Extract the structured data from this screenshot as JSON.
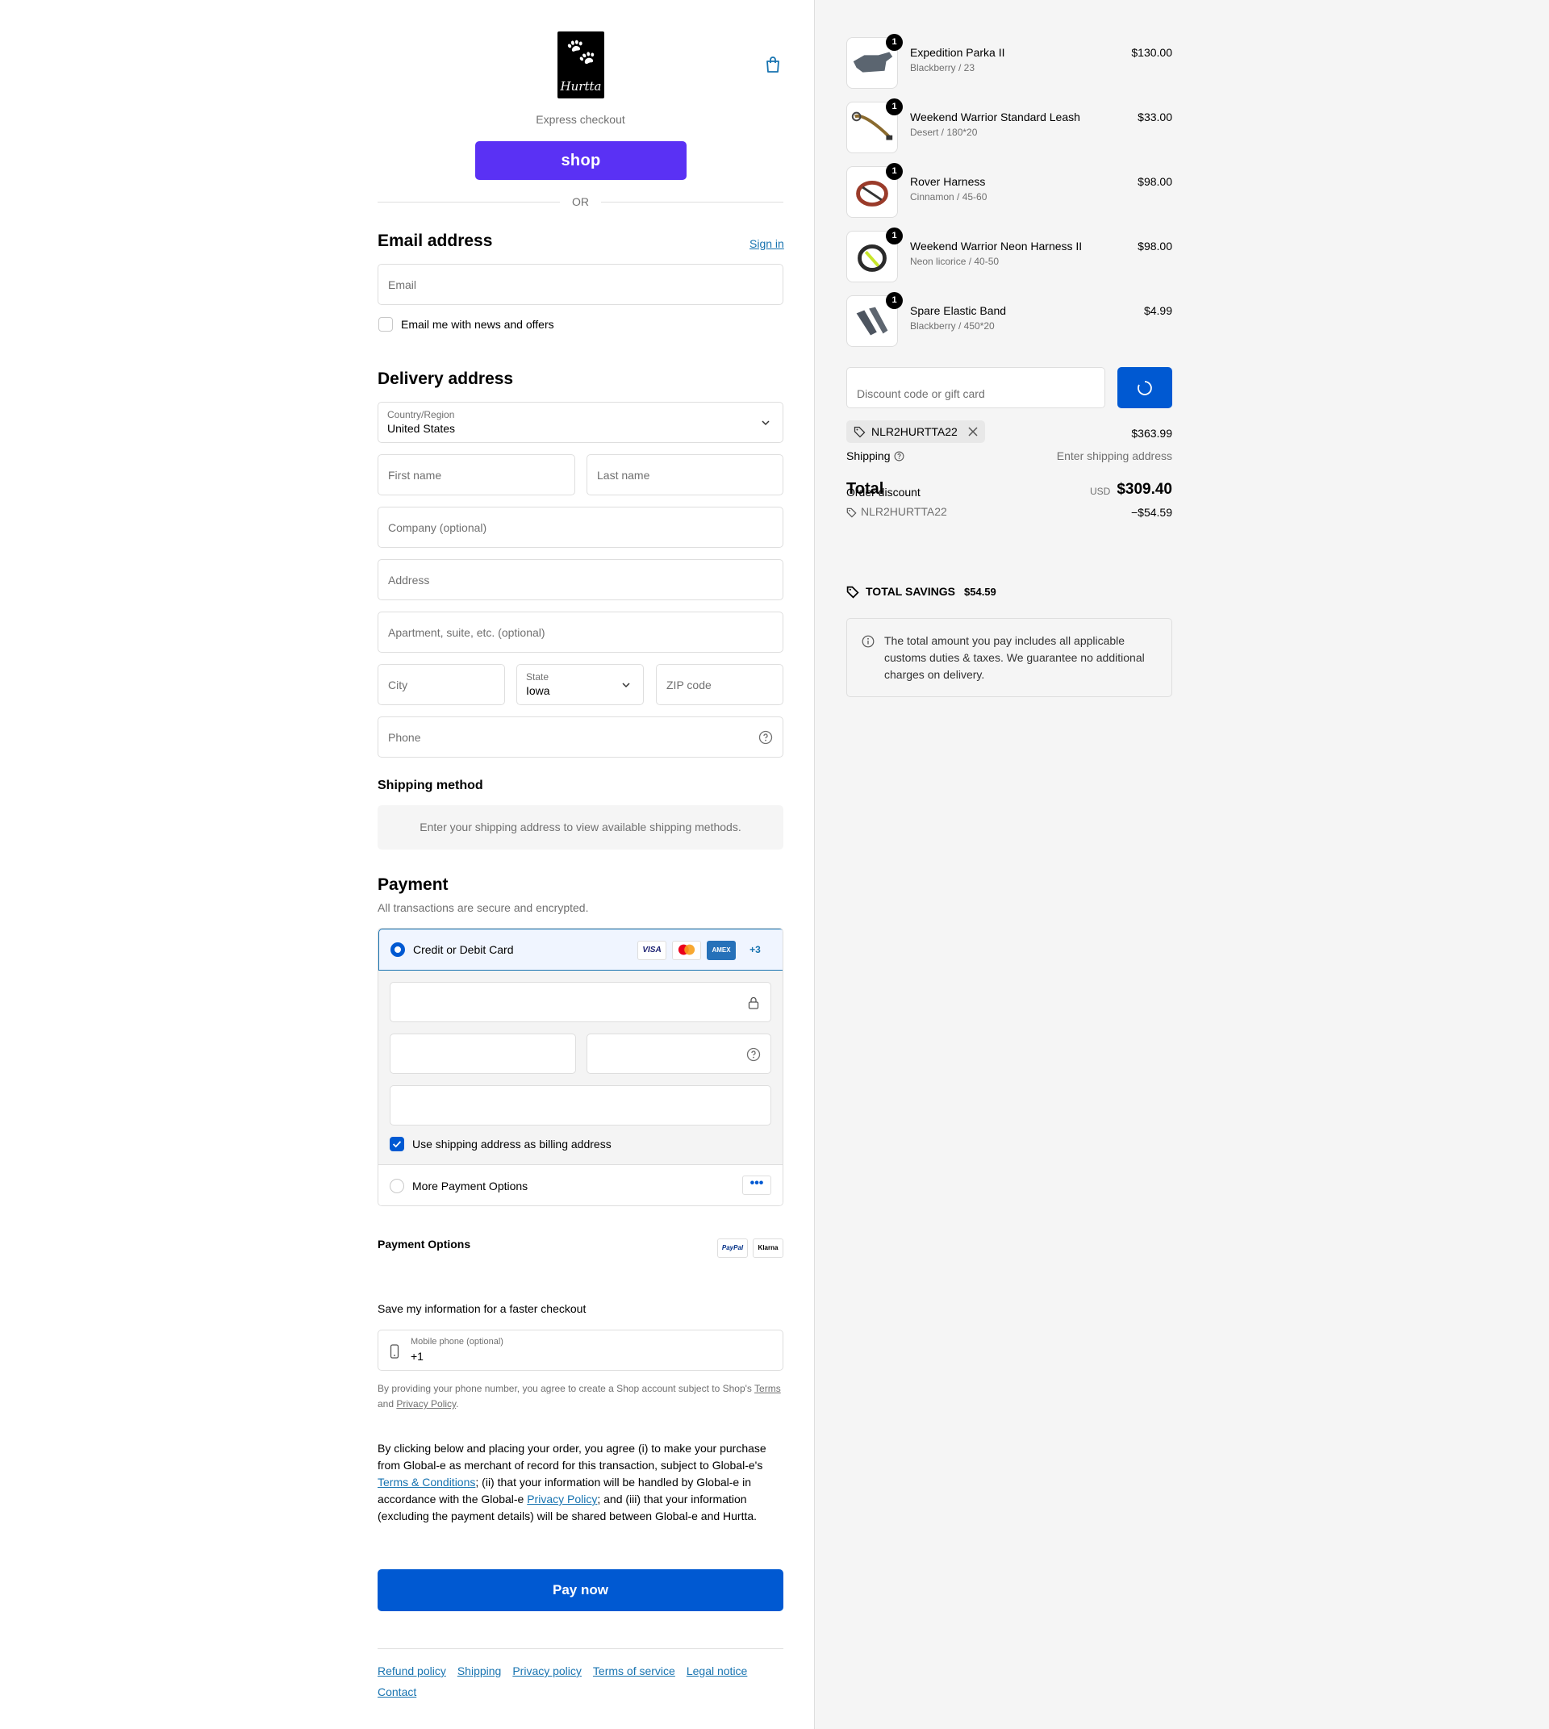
{
  "header": {
    "brand": "Hurtta",
    "express_label": "Express checkout",
    "shop_label": "shop",
    "or_label": "OR"
  },
  "email_section": {
    "title": "Email address",
    "sign_in": "Sign in",
    "email_placeholder": "Email",
    "newsletter_label": "Email me with news and offers"
  },
  "delivery": {
    "title": "Delivery address",
    "country_label": "Country/Region",
    "country_value": "United States",
    "first_name": "First name",
    "last_name": "Last name",
    "company": "Company (optional)",
    "address": "Address",
    "apartment": "Apartment, suite, etc. (optional)",
    "city": "City",
    "state_label": "State",
    "state_value": "Iowa",
    "zip": "ZIP code",
    "phone": "Phone"
  },
  "shipping_method": {
    "title": "Shipping method",
    "note": "Enter your shipping address to view available shipping methods."
  },
  "payment": {
    "title": "Payment",
    "subtitle": "All transactions are secure and encrypted.",
    "card_option": "Credit or Debit Card",
    "cards": [
      "VISA",
      "MC",
      "AMEX",
      "+3"
    ],
    "billing_label": "Use shipping address as billing address",
    "more_options": "More Payment Options",
    "options_title": "Payment Options",
    "option_badges": [
      "PayPal",
      "Klarna"
    ]
  },
  "save_info": {
    "title": "Save my information for a faster checkout",
    "mobile_label": "Mobile phone (optional)",
    "mobile_value": "+1",
    "legal_pre": "By providing your phone number, you agree to create a Shop account subject to Shop's ",
    "terms": "Terms",
    "and": " and ",
    "privacy": "Privacy Policy",
    "period": "."
  },
  "legal": {
    "part1": "By clicking below and placing your order, you agree (i) to make your purchase from Global-e as merchant of record for this transaction, subject to Global-e's ",
    "terms_link": "Terms & Conditions",
    "part2": "; (ii) that your information will be handled by Global-e in accordance with the Global-e ",
    "privacy_link": "Privacy Policy",
    "part3": "; and (iii) that your information (excluding the payment details) will be shared between Global-e and Hurtta."
  },
  "pay_now": "Pay now",
  "footer_links": [
    "Refund policy",
    "Shipping",
    "Privacy policy",
    "Terms of service",
    "Legal notice",
    "Contact"
  ],
  "cart": {
    "items": [
      {
        "name": "Expedition Parka II",
        "variant": "Blackberry / 23",
        "price": "$130.00",
        "qty": "1"
      },
      {
        "name": "Weekend Warrior Standard Leash",
        "variant": "Desert / 180*20",
        "price": "$33.00",
        "qty": "1"
      },
      {
        "name": "Rover Harness",
        "variant": "Cinnamon / 45-60",
        "price": "$98.00",
        "qty": "1"
      },
      {
        "name": "Weekend Warrior Neon Harness II",
        "variant": "Neon licorice / 40-50",
        "price": "$98.00",
        "qty": "1"
      },
      {
        "name": "Spare Elastic Band",
        "variant": "Blackberry / 450*20",
        "price": "$4.99",
        "qty": "1"
      }
    ],
    "discount_placeholder": "Discount code or gift card",
    "applied_code": "NLR2HURTTA22",
    "subtotal_value": "$363.99",
    "shipping_label": "Shipping",
    "shipping_value": "Enter shipping address",
    "order_discount_label": "Order discount",
    "discount_code": "NLR2HURTTA22",
    "discount_value": "−$54.59",
    "total_label": "Total",
    "currency": "USD",
    "total_value": "$309.40",
    "savings_label": "TOTAL SAVINGS",
    "savings_value": "$54.59",
    "duties_note": "The total amount you pay includes all applicable customs duties & taxes. We guarantee no additional charges on delivery."
  },
  "colors": {
    "accent": "#0059d2",
    "shop": "#5a31f4",
    "link": "#1773b0"
  }
}
